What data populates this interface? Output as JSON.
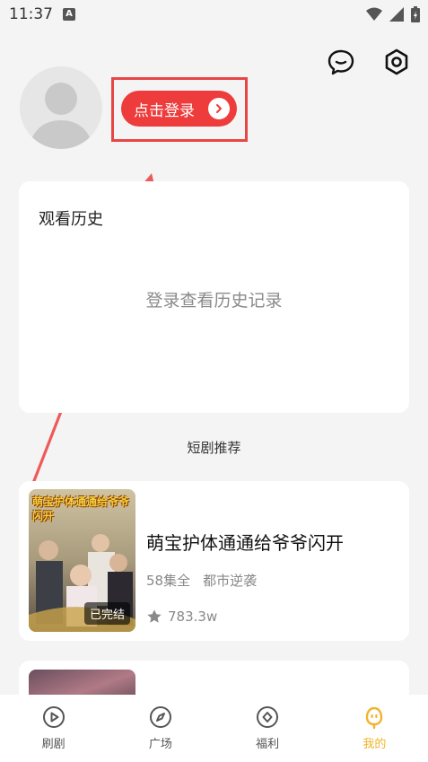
{
  "status_bar": {
    "time": "11:37",
    "badge": "A"
  },
  "header": {
    "chat_icon": "chat-bubble-icon",
    "settings_icon": "hex-settings-icon"
  },
  "profile": {
    "login_label": "点击登录"
  },
  "history": {
    "title": "观看历史",
    "empty_text": "登录查看历史记录"
  },
  "recommend": {
    "section_title": "短剧推荐",
    "items": [
      {
        "poster_title": "萌宝护体通通给爷爷闪开",
        "badge": "已完结",
        "name": "萌宝护体通通给爷爷闪开",
        "episodes": "58集全",
        "genre": "都市逆袭",
        "rating": "783.3w"
      }
    ]
  },
  "tabbar": {
    "tabs": [
      {
        "label": "刷剧",
        "icon": "play-circle-icon"
      },
      {
        "label": "广场",
        "icon": "compass-icon"
      },
      {
        "label": "福利",
        "icon": "coin-icon"
      },
      {
        "label": "我的",
        "icon": "profile-face-icon"
      }
    ],
    "active_color": "#f1b32b"
  },
  "colors": {
    "accent_red": "#ee3b3b",
    "highlight_box": "#e84545"
  }
}
